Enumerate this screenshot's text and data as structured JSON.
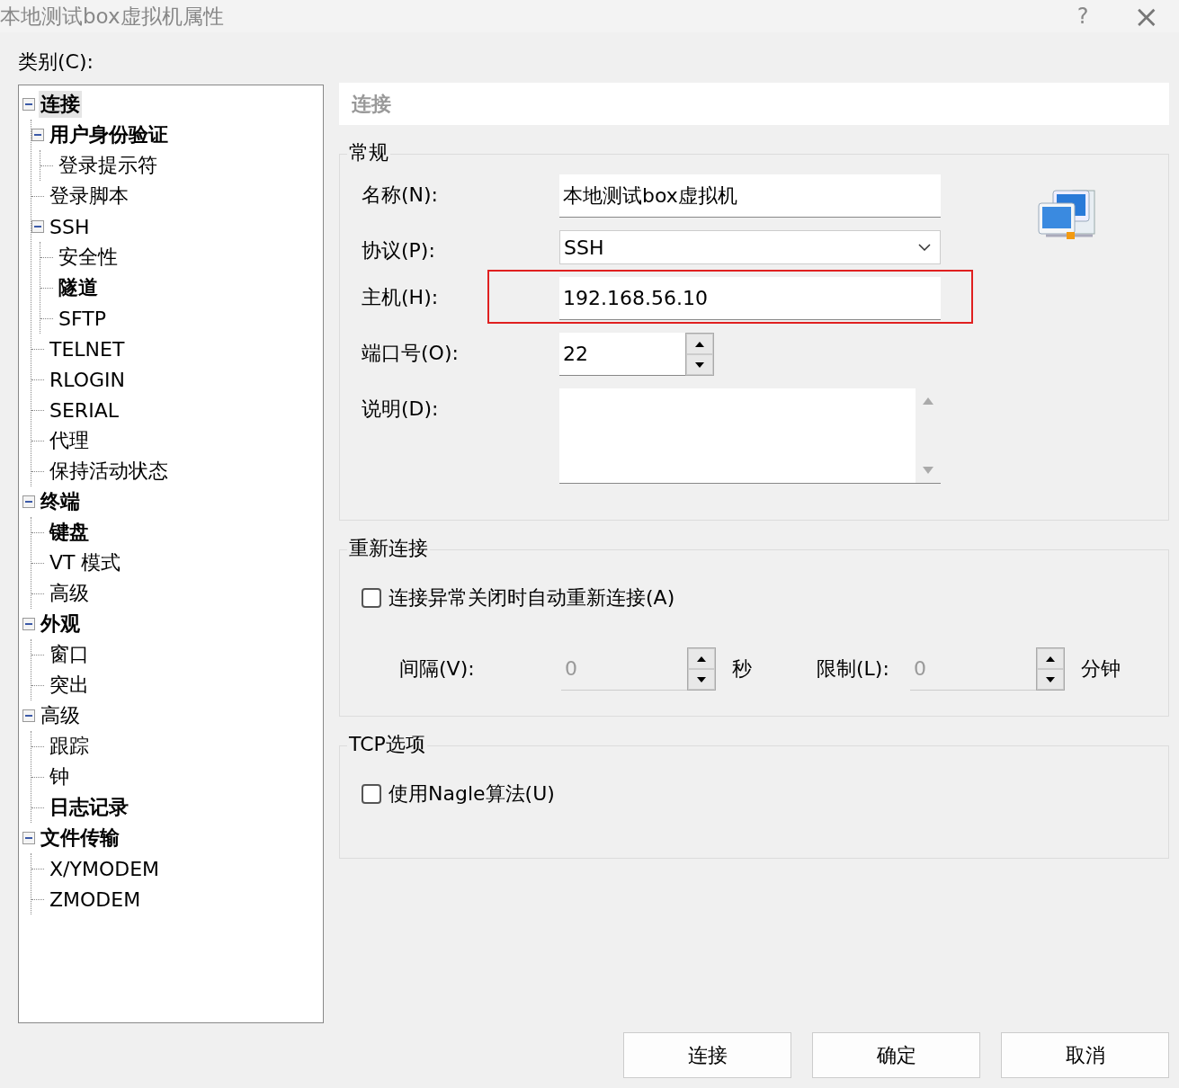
{
  "window": {
    "title": "本地测试box虚拟机属性",
    "help": "?",
    "close": "×"
  },
  "category_label": "类别(C):",
  "tree": [
    {
      "label": "连接",
      "bold": true,
      "expanded": true,
      "selected": true,
      "children": [
        {
          "label": "用户身份验证",
          "bold": true,
          "expanded": true,
          "selected": false,
          "children": [
            {
              "label": "登录提示符",
              "bold": false,
              "selected": false
            }
          ]
        },
        {
          "label": "登录脚本",
          "bold": false,
          "selected": false
        },
        {
          "label": "SSH",
          "bold": false,
          "expanded": true,
          "selected": false,
          "children": [
            {
              "label": "安全性",
              "bold": false,
              "selected": false
            },
            {
              "label": "隧道",
              "bold": true,
              "selected": false
            },
            {
              "label": "SFTP",
              "bold": false,
              "selected": false
            }
          ]
        },
        {
          "label": "TELNET",
          "bold": false,
          "selected": false
        },
        {
          "label": "RLOGIN",
          "bold": false,
          "selected": false
        },
        {
          "label": "SERIAL",
          "bold": false,
          "selected": false
        },
        {
          "label": "代理",
          "bold": false,
          "selected": false
        },
        {
          "label": "保持活动状态",
          "bold": false,
          "selected": false
        }
      ]
    },
    {
      "label": "终端",
      "bold": true,
      "expanded": true,
      "selected": false,
      "children": [
        {
          "label": "键盘",
          "bold": true,
          "selected": false
        },
        {
          "label": "VT 模式",
          "bold": false,
          "selected": false
        },
        {
          "label": "高级",
          "bold": false,
          "selected": false
        }
      ]
    },
    {
      "label": "外观",
      "bold": true,
      "expanded": true,
      "selected": false,
      "children": [
        {
          "label": "窗口",
          "bold": false,
          "selected": false
        },
        {
          "label": "突出",
          "bold": false,
          "selected": false
        }
      ]
    },
    {
      "label": "高级",
      "bold": false,
      "expanded": true,
      "selected": false,
      "children": [
        {
          "label": "跟踪",
          "bold": false,
          "selected": false
        },
        {
          "label": "钟",
          "bold": false,
          "selected": false
        },
        {
          "label": "日志记录",
          "bold": true,
          "selected": false
        }
      ]
    },
    {
      "label": "文件传输",
      "bold": true,
      "expanded": true,
      "selected": false,
      "children": [
        {
          "label": "X/YMODEM",
          "bold": false,
          "selected": false
        },
        {
          "label": "ZMODEM",
          "bold": false,
          "selected": false
        }
      ]
    }
  ],
  "panel_title": "连接",
  "general": {
    "title": "常规",
    "fields": [
      {
        "kind": "text",
        "label": "名称(N):",
        "value": "本地测试box虚拟机",
        "highlighted": false
      },
      {
        "kind": "dropdown",
        "label": "协议(P):",
        "value": "SSH",
        "highlighted": false
      },
      {
        "kind": "text",
        "label": "主机(H):",
        "value": "192.168.56.10",
        "highlighted": true
      },
      {
        "kind": "spinner",
        "label": "端口号(O):",
        "value": "22",
        "highlighted": false
      },
      {
        "kind": "textarea",
        "label": "说明(D):",
        "highlighted": false
      }
    ]
  },
  "reconnect": {
    "title": "重新连接",
    "checkbox": {
      "label": "连接异常关闭时自动重新连接(A)",
      "checked": false
    },
    "interval": {
      "label": "间隔(V):",
      "value": "0",
      "unit": "秒",
      "disabled": true
    },
    "limit": {
      "label": "限制(L):",
      "value": "0",
      "unit": "分钟",
      "disabled": true
    }
  },
  "tcp": {
    "title": "TCP选项",
    "checkbox": {
      "label": "使用Nagle算法(U)",
      "checked": false
    }
  },
  "buttons": [
    "连接",
    "确定",
    "取消"
  ]
}
